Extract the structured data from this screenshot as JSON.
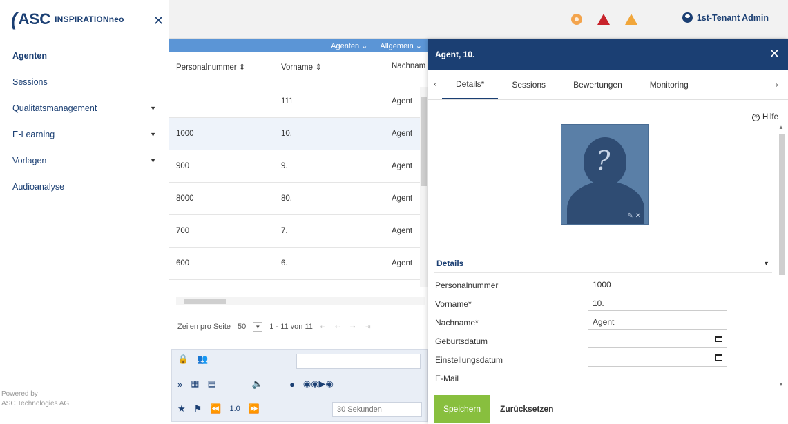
{
  "app": {
    "logo_short": "ASC",
    "logo_product": "INSPIRATIONneo",
    "powered_line1": "Powered by",
    "powered_line2": "ASC Technologies AG"
  },
  "sidebar": {
    "items": [
      {
        "label": "Agenten",
        "active": true
      },
      {
        "label": "Sessions"
      },
      {
        "label": "Qualitätsmanagement",
        "expandable": true
      },
      {
        "label": "E-Learning",
        "expandable": true
      },
      {
        "label": "Vorlagen",
        "expandable": true
      },
      {
        "label": "Audioanalyse"
      }
    ]
  },
  "topbar": {
    "user": "1st-Tenant Admin"
  },
  "grid": {
    "group_headers": [
      "Agenten ⌄",
      "Allgemein ⌄"
    ],
    "columns": [
      "Personalnummer ⇕",
      "Vorname ⇕",
      "Nachnam"
    ],
    "rows": [
      [
        "",
        "111",
        "Agent"
      ],
      [
        "1000",
        "10.",
        "Agent"
      ],
      [
        "900",
        "9.",
        "Agent"
      ],
      [
        "8000",
        "80.",
        "Agent"
      ],
      [
        "700",
        "7.",
        "Agent"
      ],
      [
        "600",
        "6.",
        "Agent"
      ]
    ],
    "pager_label": "Zeilen pro Seite",
    "pager_size": "50",
    "pager_range": "1 - 11 von 11"
  },
  "player": {
    "speed": "1.0",
    "seconds_placeholder": "30 Sekunden"
  },
  "panel": {
    "title": "Agent, 10.",
    "tabs": [
      "Details*",
      "Sessions",
      "Bewertungen",
      "Monitoring"
    ],
    "help": "Hilfe",
    "section_title": "Details",
    "fields": [
      {
        "label": "Personalnummer",
        "value": "1000"
      },
      {
        "label": "Vorname*",
        "value": "10."
      },
      {
        "label": "Nachname*",
        "value": "Agent"
      },
      {
        "label": "Geburtsdatum",
        "value": ""
      },
      {
        "label": "Einstellungsdatum",
        "value": ""
      },
      {
        "label": "E-Mail",
        "value": ""
      }
    ],
    "save_label": "Speichern",
    "reset_label": "Zurücksetzen"
  },
  "colors": {
    "brand_navy": "#1b3f73",
    "grid_header_blue": "#5b95d6",
    "save_green": "#88bf3e",
    "alert_red": "#c8232b",
    "alert_amber": "#f1a63a"
  }
}
